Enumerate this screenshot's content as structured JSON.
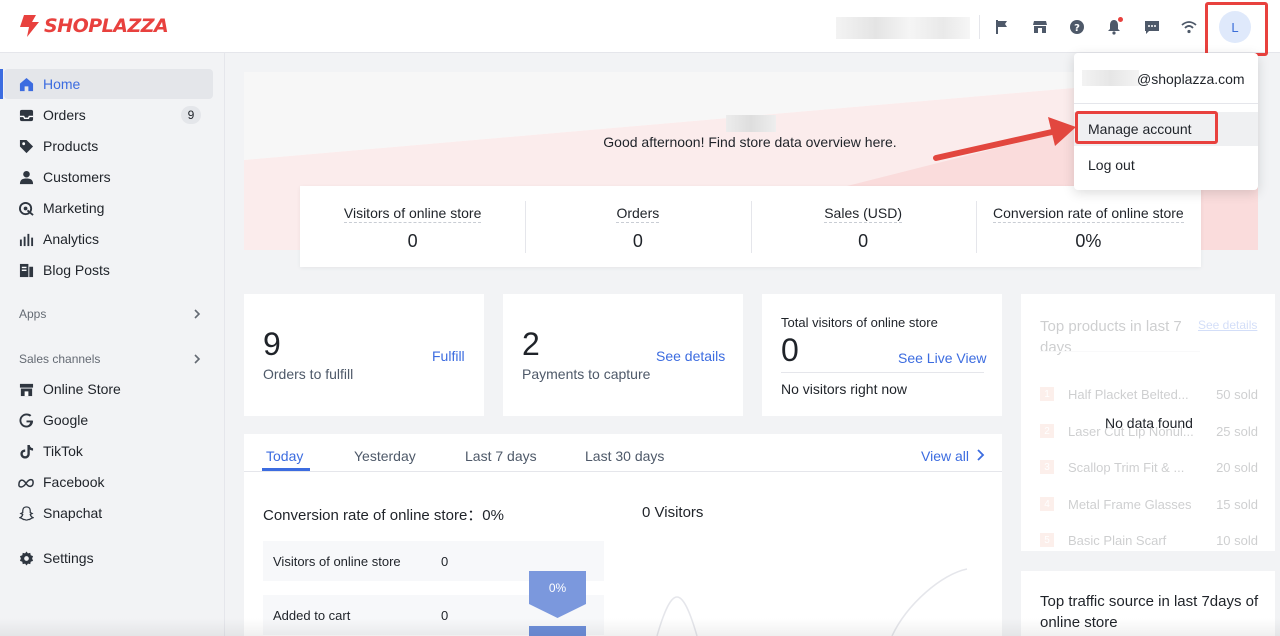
{
  "brand": {
    "name": "SHOPLAZZA",
    "accent": "#e8413e",
    "link": "#3c6ce0"
  },
  "topbar": {
    "icons": [
      "flag-icon",
      "store-icon",
      "help-icon",
      "bell-icon",
      "chat-icon",
      "wifi-icon"
    ],
    "avatar_letter": "L"
  },
  "sidebar": {
    "items": [
      {
        "label": "Home",
        "icon": "home-icon"
      },
      {
        "label": "Orders",
        "icon": "orders-icon",
        "badge": "9"
      },
      {
        "label": "Products",
        "icon": "tag-icon"
      },
      {
        "label": "Customers",
        "icon": "person-icon"
      },
      {
        "label": "Marketing",
        "icon": "marketing-icon"
      },
      {
        "label": "Analytics",
        "icon": "analytics-icon"
      },
      {
        "label": "Blog Posts",
        "icon": "blog-icon"
      }
    ],
    "apps_label": "Apps",
    "sales_channels_label": "Sales channels",
    "channels": [
      {
        "label": "Online Store",
        "icon": "online-store-icon"
      },
      {
        "label": "Google",
        "icon": "google-icon"
      },
      {
        "label": "TikTok",
        "icon": "tiktok-icon"
      },
      {
        "label": "Facebook",
        "icon": "facebook-icon"
      },
      {
        "label": "Snapchat",
        "icon": "snapchat-icon"
      }
    ],
    "settings_label": "Settings"
  },
  "hero": {
    "greeting": "Good afternoon! Find store data overview here."
  },
  "stats": [
    {
      "label": "Visitors of online store",
      "value": "0"
    },
    {
      "label": "Orders",
      "value": "0"
    },
    {
      "label": "Sales (USD)",
      "value": "0"
    },
    {
      "label": "Conversion rate of online store",
      "value": "0%"
    }
  ],
  "cards": {
    "fulfill": {
      "count": "9",
      "label": "Orders to fulfill",
      "link": "Fulfill"
    },
    "capture": {
      "count": "2",
      "label": "Payments to capture",
      "link": "See details"
    },
    "visitors": {
      "title": "Total visitors of online store",
      "count": "0",
      "link": "See Live View",
      "note": "No visitors right now"
    }
  },
  "analytics": {
    "tabs": [
      "Today",
      "Yesterday",
      "Last 7 days",
      "Last 30 days"
    ],
    "view_all": "View all",
    "conversion_title": "Conversion rate of online store：0%",
    "visitors_title": "0 Visitors",
    "funnel": [
      {
        "label": "Visitors of online store",
        "value": "0"
      },
      {
        "label": "Added to cart",
        "value": "0"
      }
    ],
    "funnel_percent": "0%"
  },
  "top_products": {
    "title": "Top products in last 7 days",
    "link": "See details",
    "no_data": "No data found",
    "rows": [
      {
        "rank": "1",
        "name": "Half Placket Belted...",
        "sold": "50 sold"
      },
      {
        "rank": "2",
        "name": "Laser Cut Lip Nonul...",
        "sold": "25 sold"
      },
      {
        "rank": "3",
        "name": "Scallop Trim Fit & ...",
        "sold": "20 sold"
      },
      {
        "rank": "4",
        "name": "Metal Frame Glasses",
        "sold": "15 sold"
      },
      {
        "rank": "5",
        "name": "Basic Plain Scarf",
        "sold": "10 sold"
      }
    ]
  },
  "top_traffic": {
    "title": "Top traffic source in last 7days of online store"
  },
  "dropdown": {
    "email_suffix": "@shoplazza.com",
    "manage_account": "Manage account",
    "log_out": "Log out"
  }
}
